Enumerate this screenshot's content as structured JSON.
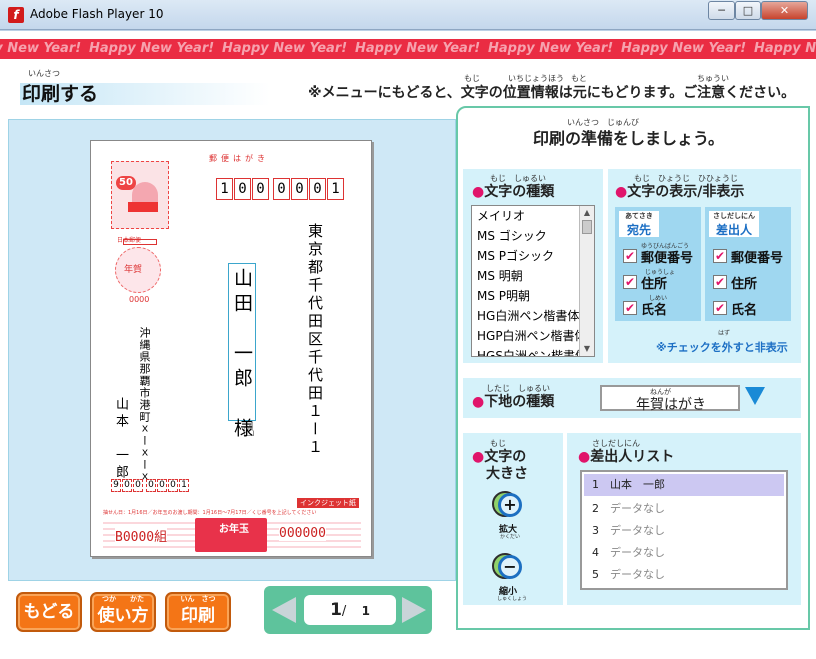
{
  "window": {
    "title": "Adobe Flash Player 10",
    "minimize": "─",
    "maximize": "□",
    "close": "✕"
  },
  "banner": {
    "text": "Happy New Year!"
  },
  "header": {
    "title_ruby": "いんさつ",
    "title": "印刷する",
    "notice": "※メニューにもどると、文字の位置情報は元にもどります。ご注意ください。",
    "notice_ruby": [
      "もじ",
      "いちじょうほう",
      "もと",
      "ちゅうい"
    ]
  },
  "postcard": {
    "header_label": "郵便はがき",
    "stamp_value": "50",
    "stamp_sub": "日本郵便",
    "lottery_label": "年賀",
    "lottery_num": "0000",
    "zip_digits": [
      "1",
      "0",
      "0",
      "0",
      "0",
      "0",
      "1"
    ],
    "recipient_address": "東京都千代田区千代田１ー１",
    "recipient_name": "山田　一郎　様",
    "sender_address": "沖縄県那覇市港町ｘーｘーｘ",
    "sender_name": "山本　一郎",
    "sender_zip": [
      "9",
      "0",
      "0",
      "0",
      "0",
      "0",
      "1"
    ],
    "inkjet_label": "インクジェット紙",
    "fine_print": "抽せん日：1月16日／お年玉のお渡し期間：1月16日〜7月17日／くじ番号を上記してください",
    "lottery_id_left": "B0000組",
    "lottery_id_right": "000000",
    "otoshidama": "お年玉"
  },
  "panel": {
    "heading_ruby": "いんさつ　じゅんび",
    "heading": "印刷の準備をしましょう。"
  },
  "font_type": {
    "ruby": "もじ　しゅるい",
    "title": "文字の種類",
    "fonts": [
      "メイリオ",
      "MS ゴシック",
      "MS Pゴシック",
      "MS 明朝",
      "MS P明朝",
      "HG白洲ペン楷書体",
      "HGP白洲ペン楷書体",
      "HGS白洲ペン楷書体"
    ]
  },
  "display": {
    "ruby": "もじ　ひょうじ　ひひょうじ",
    "title": "文字の表示/非表示",
    "dest_ruby": "あてさき",
    "dest": "宛先",
    "sender_ruby": "さしだしにん",
    "sender": "差出人",
    "dest_items": [
      "郵便番号",
      "住所",
      "氏名"
    ],
    "sender_items": [
      "郵便番号",
      "住所",
      "氏名"
    ],
    "dest_item_ruby": [
      "ゆうびんばんごう",
      "じゅうしょ",
      "しめい"
    ],
    "note": "※チェックを外すと非表示",
    "note_ruby": "はず"
  },
  "background": {
    "ruby": "したじ　しゅるい",
    "title": "下地の種類",
    "value_ruby": "ねんが",
    "value": "年賀はがき"
  },
  "text_size": {
    "ruby": "もじ",
    "title1": "文字の",
    "title2": "大きさ",
    "zoom_in": "拡大",
    "zoom_in_ruby": "かくだい",
    "zoom_out": "縮小",
    "zoom_out_ruby": "しゅくしょう"
  },
  "sender_list": {
    "ruby": "さしだしにん",
    "title": "差出人リスト",
    "items": [
      {
        "num": "1",
        "label": "山本　一郎"
      },
      {
        "num": "2",
        "label": "データなし"
      },
      {
        "num": "3",
        "label": "データなし"
      },
      {
        "num": "4",
        "label": "データなし"
      },
      {
        "num": "5",
        "label": "データなし"
      }
    ]
  },
  "footer": {
    "back": "もどる",
    "howto": "使い方",
    "howto_ruby": "つか　　かた",
    "print": "印刷",
    "print_ruby": "いん　さつ",
    "page_current": "1",
    "page_sep": "/",
    "page_total": "1"
  },
  "colors": {
    "accent": "#e0156b",
    "banner": "#ea2c43",
    "button": "#f47516",
    "panel_border": "#68c8a8"
  }
}
